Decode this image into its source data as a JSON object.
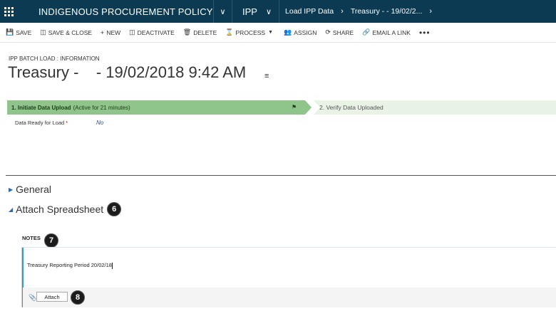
{
  "topbar": {
    "app_title": "INDIGENOUS PROCUREMENT POLICY",
    "area": "IPP",
    "breadcrumb_1": "Load IPP Data",
    "breadcrumb_2": "Treasury - - 19/02/2..."
  },
  "commands": {
    "save": "SAVE",
    "save_close": "SAVE & CLOSE",
    "new": "NEW",
    "deactivate": "DEACTIVATE",
    "delete": "DELETE",
    "process": "PROCESS",
    "assign": "ASSIGN",
    "share": "SHARE",
    "email_link": "EMAIL A LINK",
    "more": "•••"
  },
  "header": {
    "entity_label": "IPP BATCH LOAD : INFORMATION",
    "title": "Treasury -    - 19/02/2018 9:42 AM"
  },
  "process": {
    "stage1_name": "1. Initiate Data Upload",
    "stage1_status": "(Active for 21 minutes)",
    "stage2_name": "2. Verify Data Uploaded"
  },
  "fields": {
    "data_ready_label": "Data Ready for Load",
    "data_ready_required": "*",
    "data_ready_value": "No"
  },
  "sections": {
    "general": "General",
    "attach": "Attach Spreadsheet",
    "badge_attach": "6"
  },
  "notes": {
    "label": "NOTES",
    "badge": "7",
    "text": "Treasury Reporting Period 20/02/18",
    "attach_button": "Attach",
    "attach_badge": "8"
  }
}
